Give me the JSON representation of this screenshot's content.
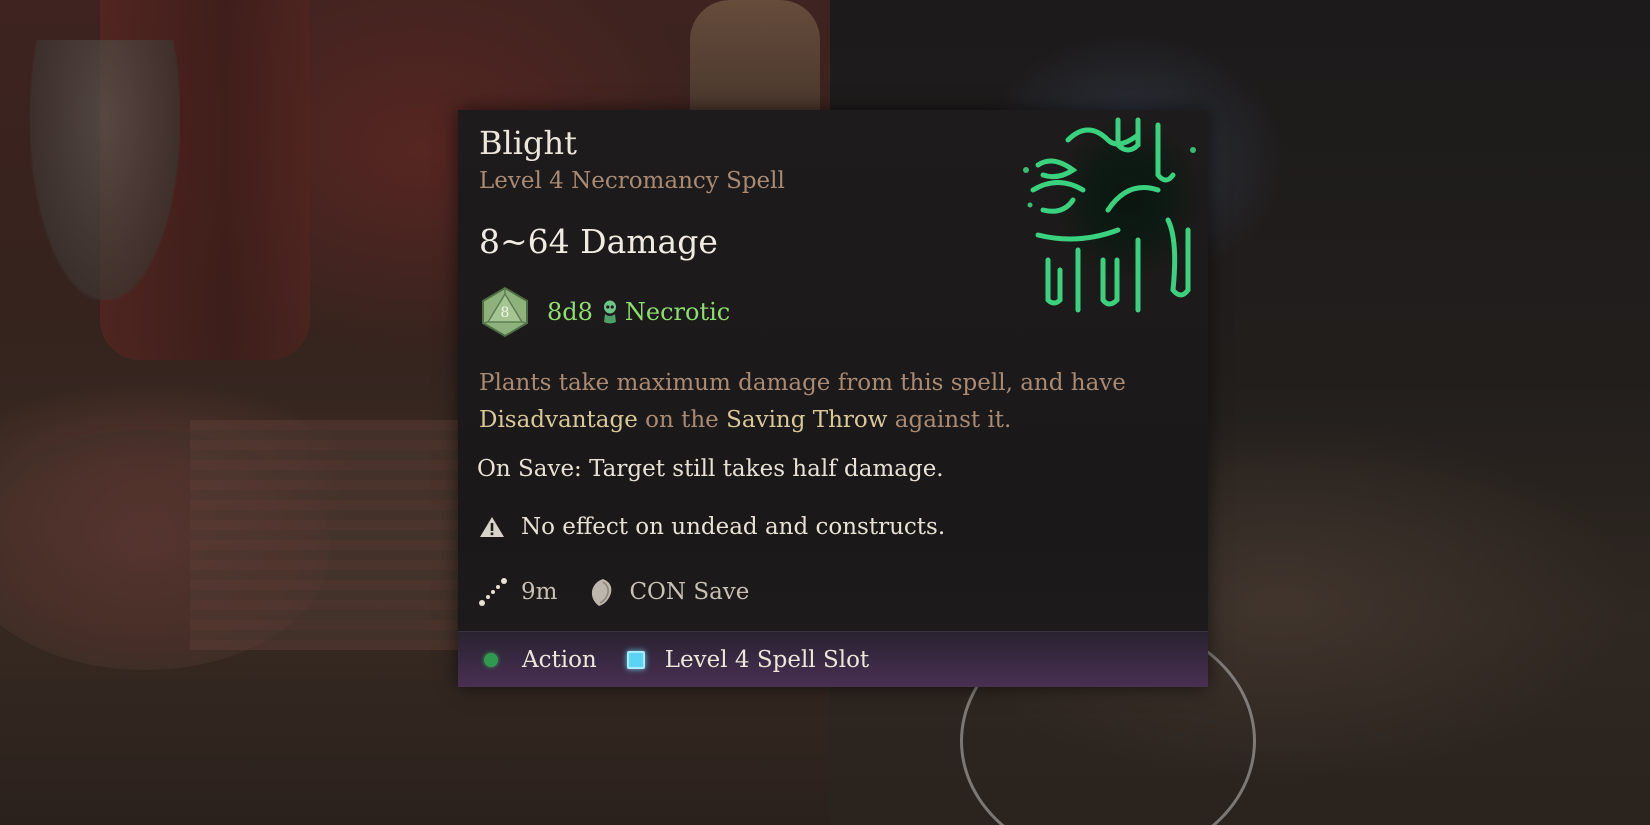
{
  "spell": {
    "name": "Blight",
    "subtitle": "Level 4 Necromancy Spell",
    "damage_range": "8~64 Damage",
    "die_face": "8",
    "dice": "8d8",
    "damage_type": "Necrotic",
    "description_parts": [
      "Plants take maximum damage from this spell, and have ",
      "Disadvantage",
      " on the ",
      "Saving Throw",
      " against it."
    ],
    "on_save": "On Save: Target still takes half damage.",
    "warning": "No effect on undead and constructs.",
    "range": "9m",
    "save": "CON Save",
    "cost_action": "Action",
    "cost_slot": "Level 4 Spell Slot"
  },
  "icons": {
    "die": "d8-die-icon",
    "damage_type": "necrotic-skull-icon",
    "warning": "warning-triangle-icon",
    "range": "range-dotted-line-icon",
    "save": "shield-save-icon",
    "action": "action-dot-icon",
    "slot": "spell-slot-icon",
    "art": "blight-spell-art"
  },
  "colors": {
    "damage_type": "#8fdd70",
    "highlight": "#d9c89a",
    "subtitle": "#a98a74",
    "action": "#2f9a4e",
    "slot": "#59d4f2"
  }
}
